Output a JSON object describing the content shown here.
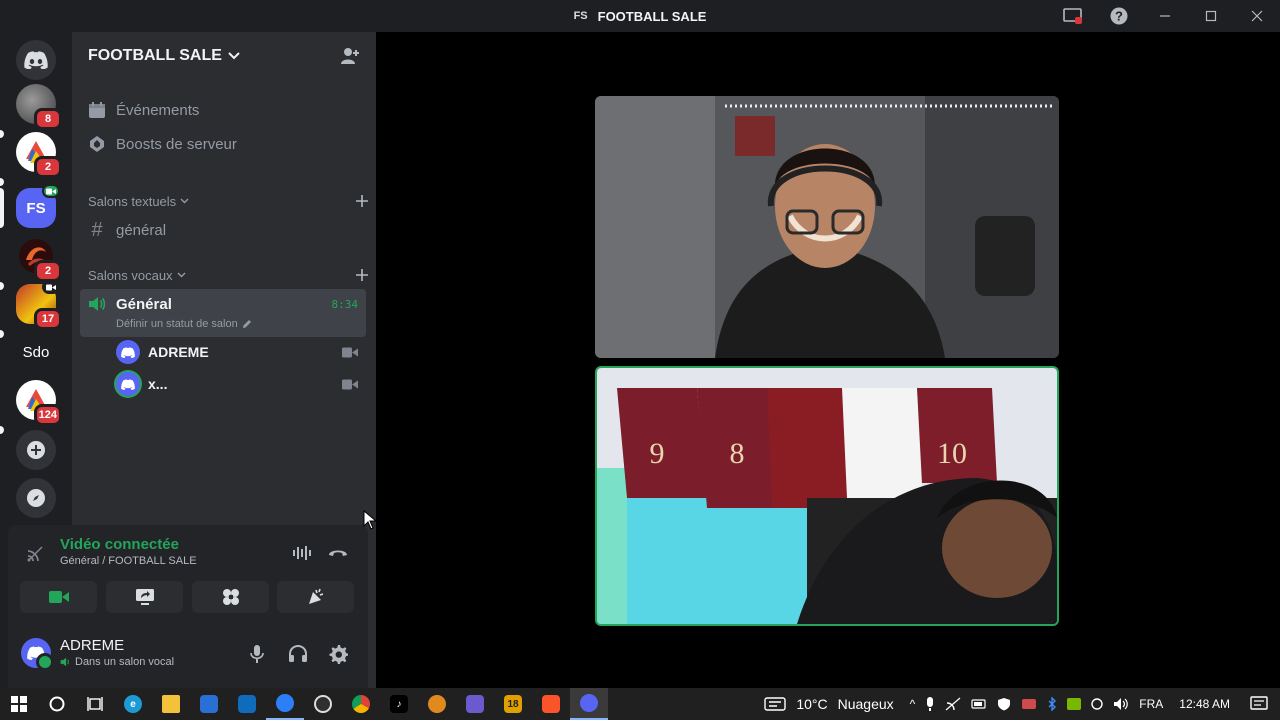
{
  "window": {
    "title": "FOOTBALL SALE",
    "title_icon": "FS"
  },
  "guilds": {
    "items": [
      {
        "label": "",
        "badge": "8"
      },
      {
        "label": "",
        "badge": "2"
      },
      {
        "label": "FS",
        "badge": ""
      },
      {
        "label": "",
        "badge": "2"
      },
      {
        "label": "",
        "badge": "17"
      },
      {
        "label": "Sdo",
        "badge": ""
      },
      {
        "label": "",
        "badge": "124"
      }
    ]
  },
  "sidebar": {
    "server_name": "FOOTBALL SALE",
    "events_label": "Événements",
    "boosts_label": "Boosts de serveur",
    "text_category": "Salons textuels",
    "text_channel": "général",
    "voice_category": "Salons vocaux",
    "voice_channel": "Général",
    "voice_timer": "8:34",
    "voice_status_placeholder": "Définir un statut de salon",
    "members": [
      {
        "name": "ADREME"
      },
      {
        "name": "x..."
      }
    ]
  },
  "rtc": {
    "status": "Vidéo connectée",
    "location": "Général / FOOTBALL SALE"
  },
  "user": {
    "name": "ADREME",
    "status": "Dans un salon vocal"
  },
  "taskbar": {
    "weather_temp": "10°C",
    "weather_desc": "Nuageux",
    "language": "FRA",
    "time": "12:48 AM",
    "badge_18": "18"
  },
  "colors": {
    "accent": "#5865f2",
    "green": "#23a55a",
    "red_badge": "#da373c",
    "speaking_border": "#23a55a"
  }
}
